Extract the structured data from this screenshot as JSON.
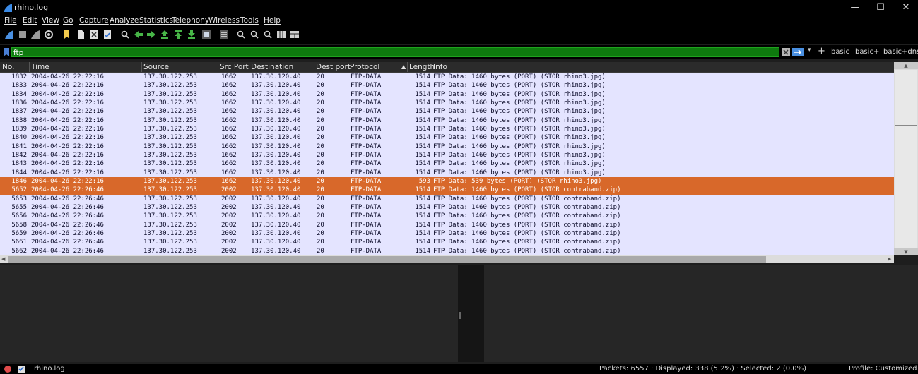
{
  "window": {
    "title": "rhino.log",
    "controls": [
      "—",
      "☐",
      "✕"
    ]
  },
  "menu": [
    "File",
    "Edit",
    "View",
    "Go",
    "Capture",
    "Analyze",
    "Statistics",
    "Telephony",
    "Wireless",
    "Tools",
    "Help"
  ],
  "toolbar_icons": [
    "shark-fin-icon",
    "stop-icon",
    "restart-icon",
    "options-icon",
    "open-icon",
    "file-icon",
    "close-file-icon",
    "reload-icon",
    "find-icon",
    "back-icon",
    "forward-icon",
    "goto-icon",
    "first-packet-icon",
    "last-packet-icon",
    "autoscroll-icon",
    "colorize-icon",
    "zoom-in-icon",
    "zoom-out-icon",
    "normal-size-icon",
    "resize-columns-icon",
    "layout-icon"
  ],
  "filter": {
    "value": "ftp",
    "buttons": [
      "basic",
      "basic+",
      "basic+dns"
    ]
  },
  "columns": [
    "No.",
    "Time",
    "Source",
    "Src Port",
    "Destination",
    "Dest port",
    "Protocol",
    "Length",
    "Info"
  ],
  "packets": [
    [
      "1832",
      "2004-04-26 22:22:16",
      "137.30.122.253",
      "1662",
      "137.30.120.40",
      "20",
      "FTP-DATA",
      "1514",
      "FTP Data: 1460 bytes (PORT) (STOR rhino3.jpg)"
    ],
    [
      "1833",
      "2004-04-26 22:22:16",
      "137.30.122.253",
      "1662",
      "137.30.120.40",
      "20",
      "FTP-DATA",
      "1514",
      "FTP Data: 1460 bytes (PORT) (STOR rhino3.jpg)"
    ],
    [
      "1834",
      "2004-04-26 22:22:16",
      "137.30.122.253",
      "1662",
      "137.30.120.40",
      "20",
      "FTP-DATA",
      "1514",
      "FTP Data: 1460 bytes (PORT) (STOR rhino3.jpg)"
    ],
    [
      "1836",
      "2004-04-26 22:22:16",
      "137.30.122.253",
      "1662",
      "137.30.120.40",
      "20",
      "FTP-DATA",
      "1514",
      "FTP Data: 1460 bytes (PORT) (STOR rhino3.jpg)"
    ],
    [
      "1837",
      "2004-04-26 22:22:16",
      "137.30.122.253",
      "1662",
      "137.30.120.40",
      "20",
      "FTP-DATA",
      "1514",
      "FTP Data: 1460 bytes (PORT) (STOR rhino3.jpg)"
    ],
    [
      "1838",
      "2004-04-26 22:22:16",
      "137.30.122.253",
      "1662",
      "137.30.120.40",
      "20",
      "FTP-DATA",
      "1514",
      "FTP Data: 1460 bytes (PORT) (STOR rhino3.jpg)"
    ],
    [
      "1839",
      "2004-04-26 22:22:16",
      "137.30.122.253",
      "1662",
      "137.30.120.40",
      "20",
      "FTP-DATA",
      "1514",
      "FTP Data: 1460 bytes (PORT) (STOR rhino3.jpg)"
    ],
    [
      "1840",
      "2004-04-26 22:22:16",
      "137.30.122.253",
      "1662",
      "137.30.120.40",
      "20",
      "FTP-DATA",
      "1514",
      "FTP Data: 1460 bytes (PORT) (STOR rhino3.jpg)"
    ],
    [
      "1841",
      "2004-04-26 22:22:16",
      "137.30.122.253",
      "1662",
      "137.30.120.40",
      "20",
      "FTP-DATA",
      "1514",
      "FTP Data: 1460 bytes (PORT) (STOR rhino3.jpg)"
    ],
    [
      "1842",
      "2004-04-26 22:22:16",
      "137.30.122.253",
      "1662",
      "137.30.120.40",
      "20",
      "FTP-DATA",
      "1514",
      "FTP Data: 1460 bytes (PORT) (STOR rhino3.jpg)"
    ],
    [
      "1843",
      "2004-04-26 22:22:16",
      "137.30.122.253",
      "1662",
      "137.30.120.40",
      "20",
      "FTP-DATA",
      "1514",
      "FTP Data: 1460 bytes (PORT) (STOR rhino3.jpg)"
    ],
    [
      "1844",
      "2004-04-26 22:22:16",
      "137.30.122.253",
      "1662",
      "137.30.120.40",
      "20",
      "FTP-DATA",
      "1514",
      "FTP Data: 1460 bytes (PORT) (STOR rhino3.jpg)"
    ],
    [
      "1846",
      "2004-04-26 22:22:16",
      "137.30.122.253",
      "1662",
      "137.30.120.40",
      "20",
      "FTP-DATA",
      "593",
      "FTP Data: 539 bytes (PORT) (STOR rhino3.jpg)"
    ],
    [
      "5652",
      "2004-04-26 22:26:46",
      "137.30.122.253",
      "2002",
      "137.30.120.40",
      "20",
      "FTP-DATA",
      "1514",
      "FTP Data: 1460 bytes (PORT) (STOR contraband.zip)"
    ],
    [
      "5653",
      "2004-04-26 22:26:46",
      "137.30.122.253",
      "2002",
      "137.30.120.40",
      "20",
      "FTP-DATA",
      "1514",
      "FTP Data: 1460 bytes (PORT) (STOR contraband.zip)"
    ],
    [
      "5655",
      "2004-04-26 22:26:46",
      "137.30.122.253",
      "2002",
      "137.30.120.40",
      "20",
      "FTP-DATA",
      "1514",
      "FTP Data: 1460 bytes (PORT) (STOR contraband.zip)"
    ],
    [
      "5656",
      "2004-04-26 22:26:46",
      "137.30.122.253",
      "2002",
      "137.30.120.40",
      "20",
      "FTP-DATA",
      "1514",
      "FTP Data: 1460 bytes (PORT) (STOR contraband.zip)"
    ],
    [
      "5658",
      "2004-04-26 22:26:46",
      "137.30.122.253",
      "2002",
      "137.30.120.40",
      "20",
      "FTP-DATA",
      "1514",
      "FTP Data: 1460 bytes (PORT) (STOR contraband.zip)"
    ],
    [
      "5659",
      "2004-04-26 22:26:46",
      "137.30.122.253",
      "2002",
      "137.30.120.40",
      "20",
      "FTP-DATA",
      "1514",
      "FTP Data: 1460 bytes (PORT) (STOR contraband.zip)"
    ],
    [
      "5661",
      "2004-04-26 22:26:46",
      "137.30.122.253",
      "2002",
      "137.30.120.40",
      "20",
      "FTP-DATA",
      "1514",
      "FTP Data: 1460 bytes (PORT) (STOR contraband.zip)"
    ],
    [
      "5662",
      "2004-04-26 22:26:46",
      "137.30.122.253",
      "2002",
      "137.30.120.40",
      "20",
      "FTP-DATA",
      "1514",
      "FTP Data: 1460 bytes (PORT) (STOR contraband.zip)"
    ]
  ],
  "selected_rows": [
    12,
    13
  ],
  "colors": {
    "row_bg": "#e4e4ff",
    "selected_bg": "#d8682a",
    "filter_bg": "#0e7a0e"
  },
  "status": {
    "file": "rhino.log",
    "packets": "Packets: 6557 · Displayed: 338 (5.2%) · Selected: 2 (0.0%)",
    "profile": "Profile: Customized"
  }
}
